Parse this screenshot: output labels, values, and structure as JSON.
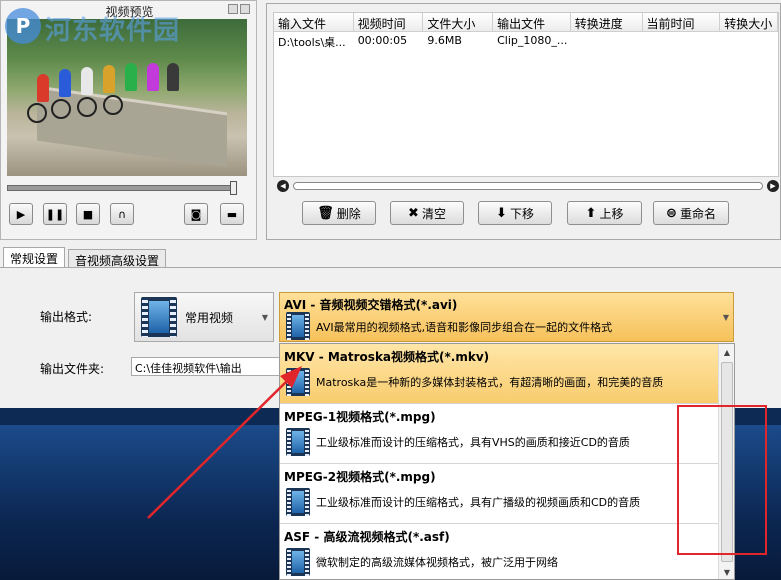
{
  "watermark": {
    "logo": "P",
    "text": "河东软件园"
  },
  "preview": {
    "title": "视频预览",
    "seek_value": 1.0
  },
  "player_buttons": [
    {
      "name": "play-icon",
      "glyph": "▶"
    },
    {
      "name": "pause-icon",
      "glyph": "❚❚"
    },
    {
      "name": "stop-icon",
      "glyph": "■"
    },
    {
      "name": "headphones-icon",
      "glyph": "∩"
    },
    {
      "name": "camera-icon",
      "glyph": "◙"
    },
    {
      "name": "folder-icon",
      "glyph": "▬"
    }
  ],
  "filelist": {
    "columns": [
      "输入文件",
      "视频时间",
      "文件大小",
      "输出文件",
      "转换进度",
      "当前时间",
      "转换大小"
    ],
    "rows": [
      [
        "D:\\tools\\桌...",
        "00:00:05",
        "9.6MB",
        "Clip_1080_...",
        "",
        "",
        ""
      ]
    ],
    "buttons": [
      {
        "label": "删除",
        "icon": "trash-icon",
        "glyph": "🗑"
      },
      {
        "label": "清空",
        "icon": "clear-icon",
        "glyph": "✖"
      },
      {
        "label": "下移",
        "icon": "move-down-icon",
        "glyph": "⬇"
      },
      {
        "label": "上移",
        "icon": "move-up-icon",
        "glyph": "⬆"
      },
      {
        "label": "重命名",
        "icon": "rename-icon",
        "glyph": "⊜"
      }
    ]
  },
  "tabs": [
    "常规设置",
    "音视频高级设置"
  ],
  "settings": {
    "output_format_label": "输出格式:",
    "format_category": "常用视频",
    "output_folder_label": "输出文件夹:",
    "output_folder_value": "C:\\佳佳视频软件\\输出"
  },
  "selected_format": {
    "title": "AVI - 音频视频交错格式(*.avi)",
    "desc": "AVI最常用的视频格式,语音和影像同步组合在一起的文件格式"
  },
  "format_options": [
    {
      "title": "MKV - Matroska视频格式(*.mkv)",
      "desc": "Matroska是一种新的多媒体封装格式，有超清晰的画面，和完美的音质"
    },
    {
      "title": "MPEG-1视频格式(*.mpg)",
      "desc": "工业级标准而设计的压缩格式，具有VHS的画质和接近CD的音质"
    },
    {
      "title": "MPEG-2视频格式(*.mpg)",
      "desc": "工业级标准而设计的压缩格式，具有广播级的视频画质和CD的音质"
    },
    {
      "title": "ASF - 高级流视频格式(*.asf)",
      "desc": "微软制定的高级流媒体视频格式，被广泛用于网络"
    }
  ],
  "colors": {
    "highlight": "#e0262a",
    "selected_bg": "#f8cc6e"
  }
}
